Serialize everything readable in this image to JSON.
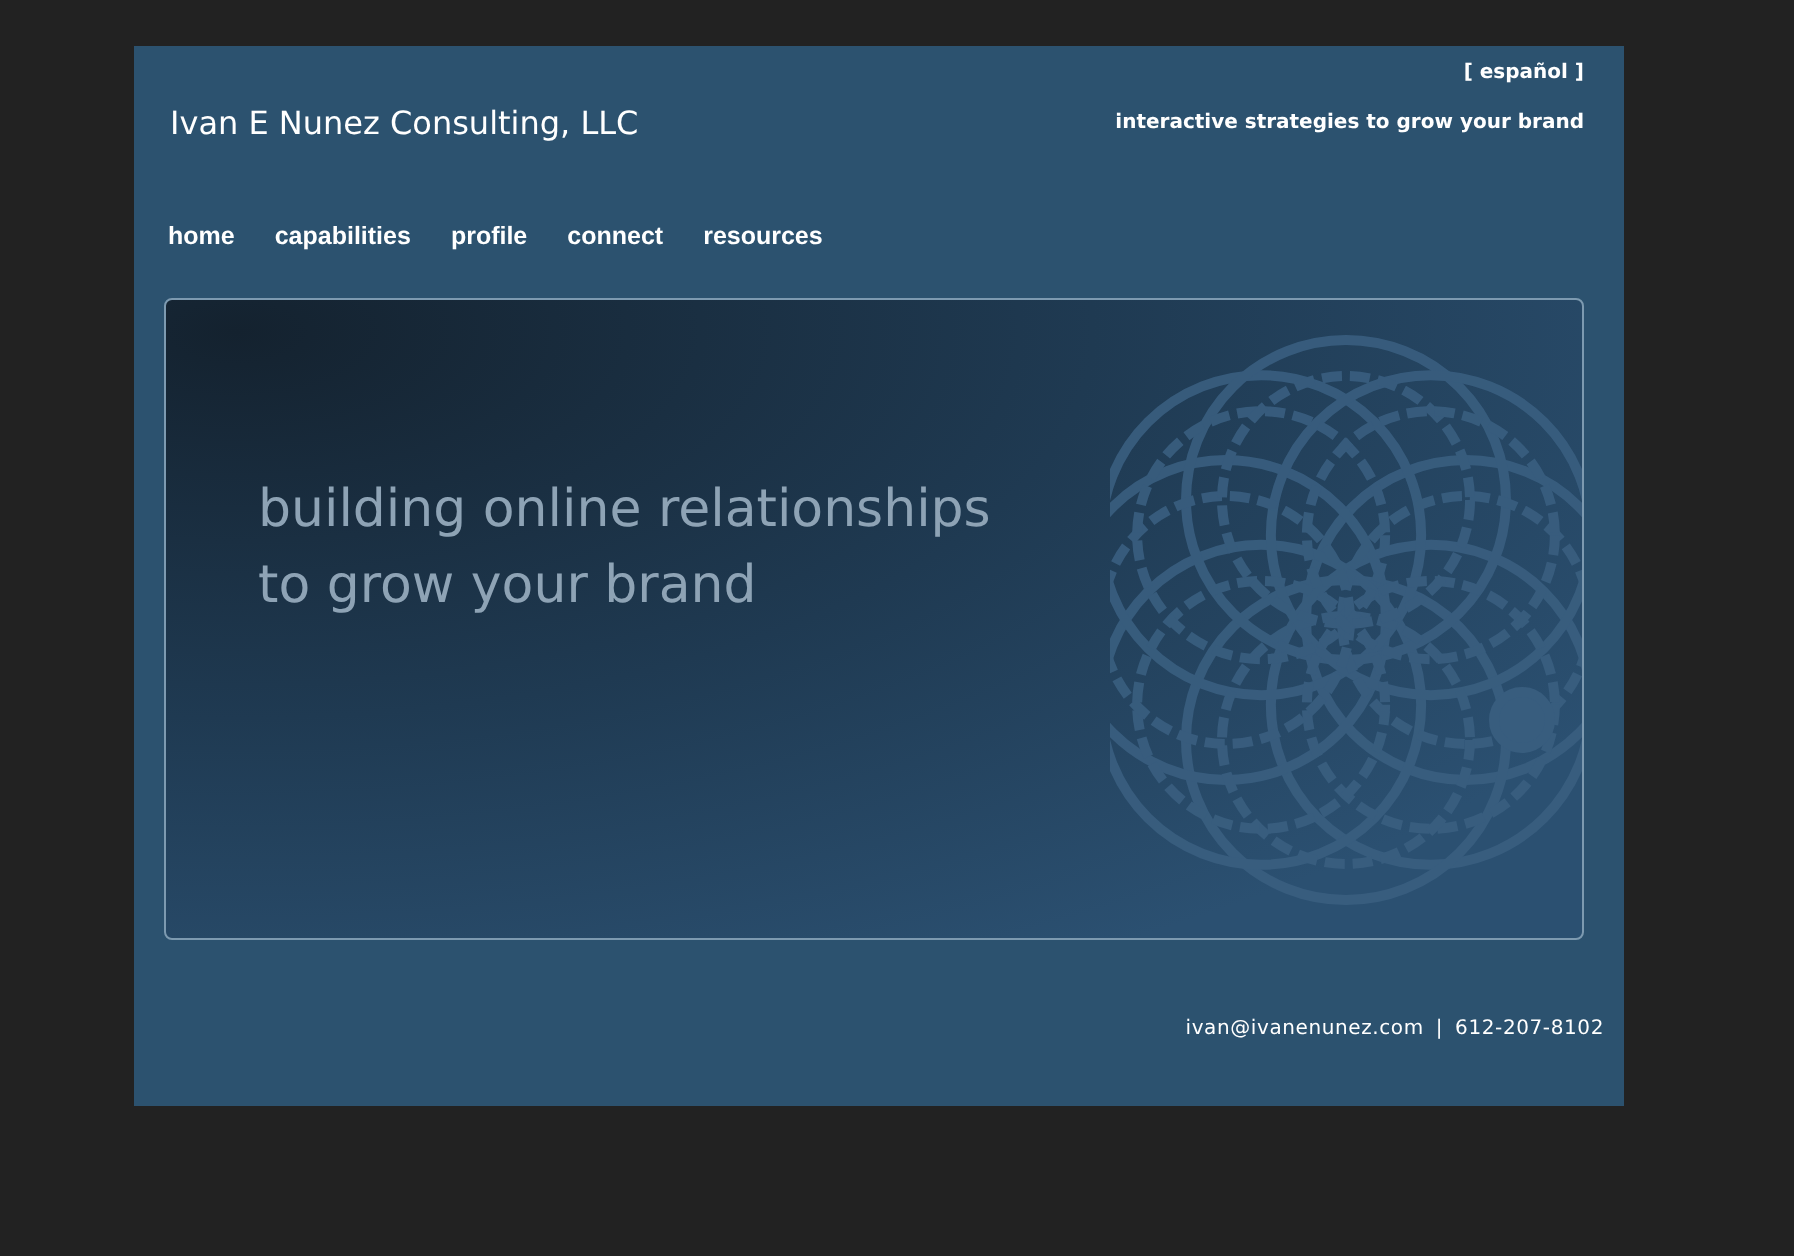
{
  "language_link": "[ español ]",
  "site_title": "Ivan E Nunez Consulting, LLC",
  "tagline": "interactive strategies to grow your brand",
  "nav": [
    "home",
    "capabilities",
    "profile",
    "connect",
    "resources"
  ],
  "hero": {
    "lines": [
      "building online relationships",
      "to grow your brand"
    ]
  },
  "footer": {
    "email": "ivan@ivanenunez.com",
    "separator": "|",
    "phone": "612-207-8102"
  }
}
